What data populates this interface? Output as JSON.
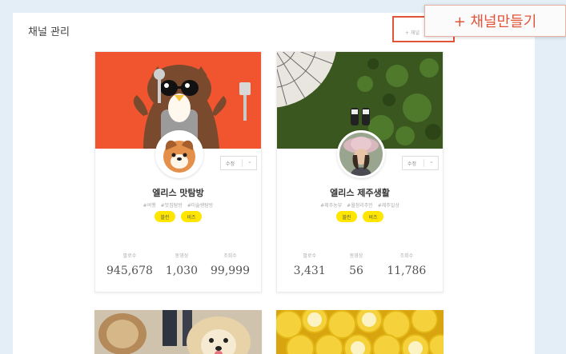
{
  "page": {
    "title": "채널 관리"
  },
  "create": {
    "small_label": "+ 채널",
    "callout_label": "+ 채널만들기"
  },
  "channels": [
    {
      "name": "엘리스 맛탐방",
      "tags": [
        "#여행",
        "#맛집탐방",
        "#미슐랭탐방"
      ],
      "pills": [
        "블린",
        "비즈"
      ],
      "edit_label": "수정",
      "stats": [
        {
          "label": "팔로수",
          "value": "945,678"
        },
        {
          "label": "동영상",
          "value": "1,030"
        },
        {
          "label": "조회수",
          "value": "99,999"
        }
      ],
      "cover_color": "#f1552f"
    },
    {
      "name": "엘리스 제주생활",
      "tags": [
        "#제주농부",
        "#월정리주민",
        "#제주일상"
      ],
      "pills": [
        "블린",
        "비즈"
      ],
      "edit_label": "수정",
      "stats": [
        {
          "label": "팔로수",
          "value": "3,431"
        },
        {
          "label": "동영상",
          "value": "56"
        },
        {
          "label": "조회수",
          "value": "11,786"
        }
      ],
      "cover_color": "#3f5a24"
    }
  ],
  "colors": {
    "accent": "#e0553a",
    "pill": "#ffe600",
    "background": "#e3eef7"
  }
}
